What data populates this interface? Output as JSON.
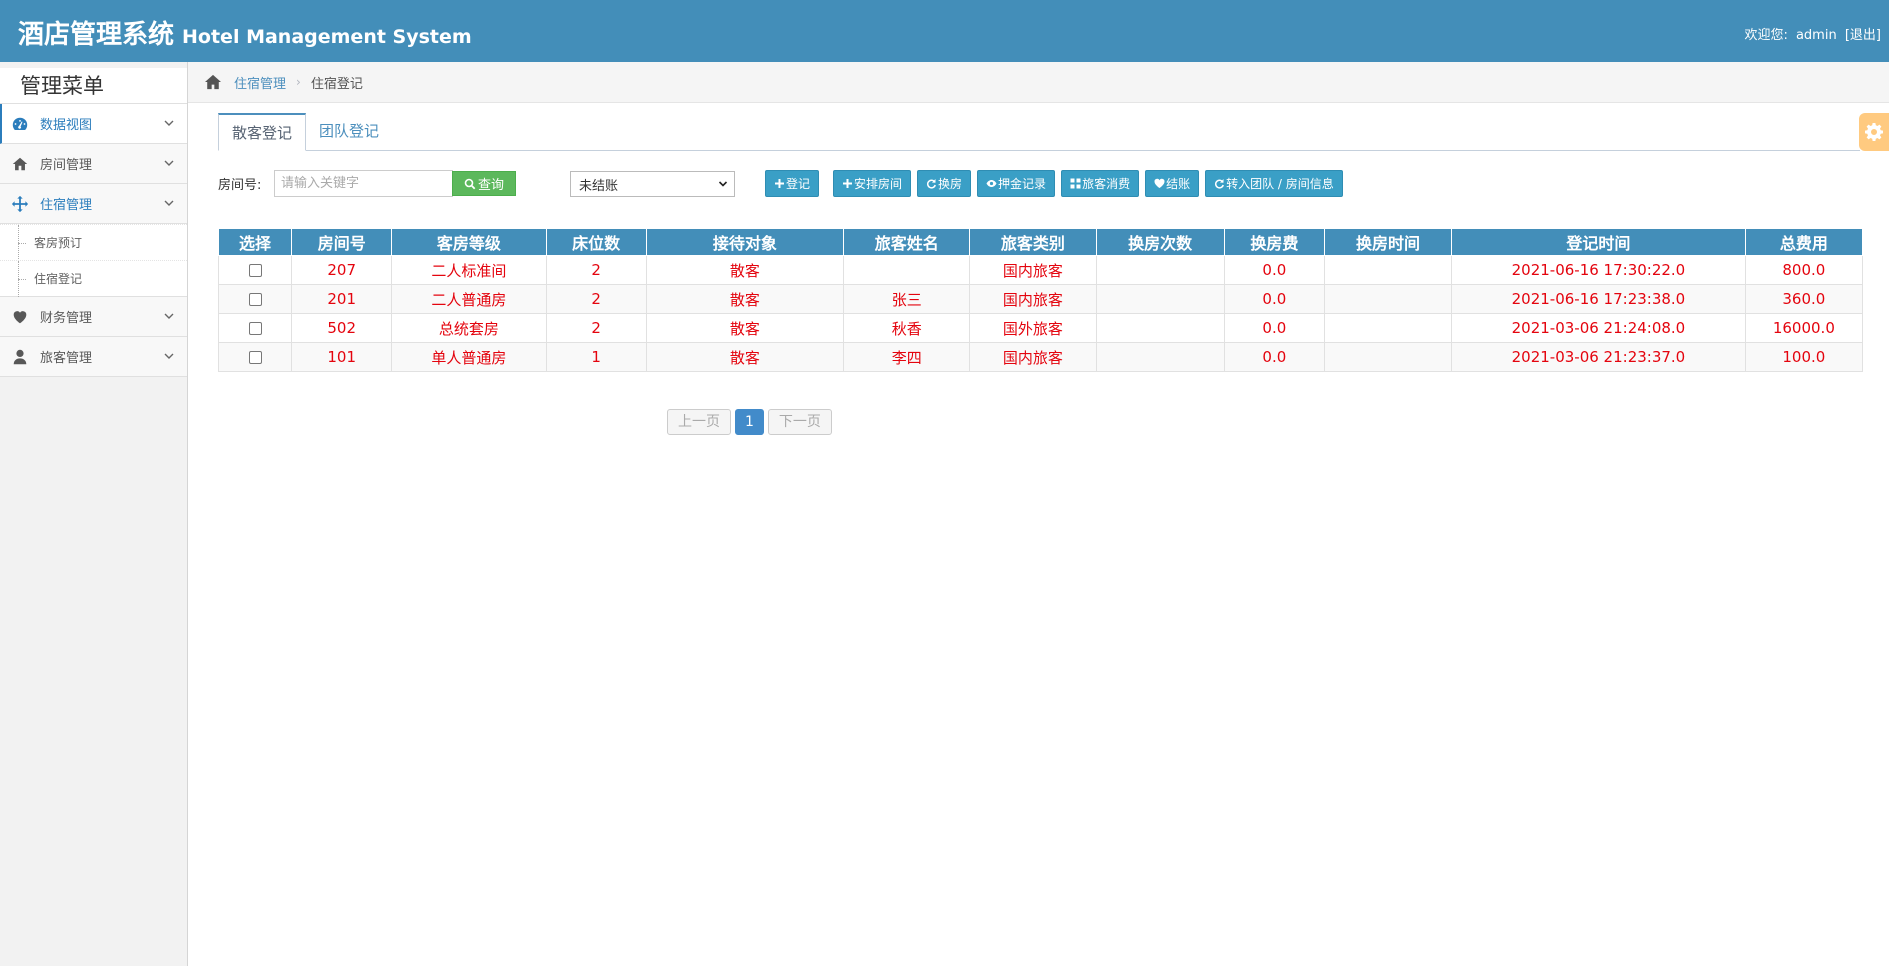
{
  "header": {
    "title_cn": "酒店管理系统",
    "title_en": "Hotel Management System",
    "welcome": "欢迎您:",
    "username": "admin",
    "logout": "[退出]"
  },
  "sidebar": {
    "title": "管理菜单",
    "items": [
      {
        "label": "数据视图",
        "icon": "dashboard-icon"
      },
      {
        "label": "房间管理",
        "icon": "home-icon"
      },
      {
        "label": "住宿管理",
        "icon": "move-icon"
      },
      {
        "label": "财务管理",
        "icon": "heart-icon"
      },
      {
        "label": "旅客管理",
        "icon": "user-icon"
      }
    ],
    "subitems": [
      {
        "label": "客房预订"
      },
      {
        "label": "住宿登记"
      }
    ]
  },
  "breadcrumb": {
    "parent": "住宿管理",
    "current": "住宿登记"
  },
  "tabs": [
    "散客登记",
    "团队登记"
  ],
  "toolbar": {
    "room_label": "房间号:",
    "search_placeholder": "请输入关键字",
    "search_button": "查询",
    "status_selected": "未结账",
    "buttons": [
      "登记",
      "安排房间",
      "换房",
      "押金记录",
      "旅客消费",
      "结账",
      "转入团队 / 房间信息"
    ]
  },
  "table": {
    "headers": [
      "选择",
      "房间号",
      "客房等级",
      "床位数",
      "接待对象",
      "旅客姓名",
      "旅客类别",
      "换房次数",
      "换房费",
      "换房时间",
      "登记时间",
      "总费用"
    ],
    "rows": [
      {
        "room": "207",
        "grade": "二人标准间",
        "beds": "2",
        "target": "散客",
        "name": "",
        "category": "国内旅客",
        "changes": "",
        "change_fee": "0.0",
        "change_time": "",
        "checkin": "2021-06-16 17:30:22.0",
        "total": "800.0"
      },
      {
        "room": "201",
        "grade": "二人普通房",
        "beds": "2",
        "target": "散客",
        "name": "张三",
        "category": "国内旅客",
        "changes": "",
        "change_fee": "0.0",
        "change_time": "",
        "checkin": "2021-06-16 17:23:38.0",
        "total": "360.0"
      },
      {
        "room": "502",
        "grade": "总统套房",
        "beds": "2",
        "target": "散客",
        "name": "秋香",
        "category": "国外旅客",
        "changes": "",
        "change_fee": "0.0",
        "change_time": "",
        "checkin": "2021-03-06 21:24:08.0",
        "total": "16000.0"
      },
      {
        "room": "101",
        "grade": "单人普通房",
        "beds": "1",
        "target": "散客",
        "name": "李四",
        "category": "国内旅客",
        "changes": "",
        "change_fee": "0.0",
        "change_time": "",
        "checkin": "2021-03-06 21:23:37.0",
        "total": "100.0"
      }
    ]
  },
  "pager": {
    "prev": "上一页",
    "current": "1",
    "next": "下一页"
  },
  "colors": {
    "header_bg": "#438eb9",
    "row_text": "#e4040e",
    "search_btn": "#5cb85c",
    "action_btn": "#3a9fc6"
  }
}
